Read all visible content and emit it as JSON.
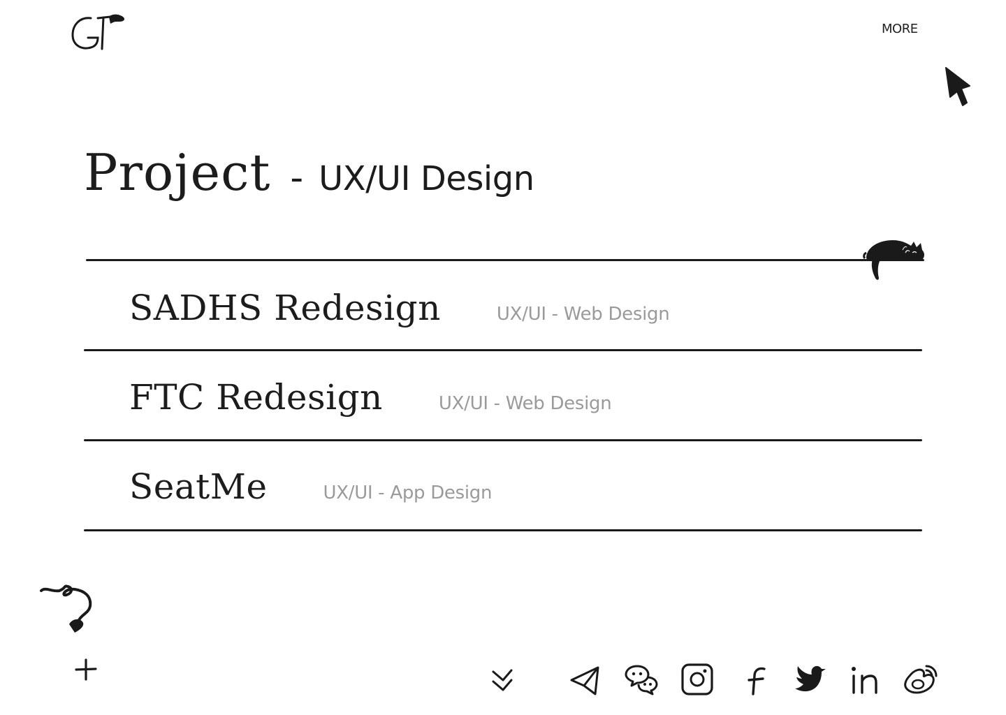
{
  "header": {
    "logo_alt": "GT",
    "more_label": "MORE"
  },
  "page": {
    "title": "Project",
    "separator": "-",
    "subtitle": "UX/UI Design"
  },
  "projects": [
    {
      "name": "SADHS Redesign",
      "category": "UX/UI - Web Design"
    },
    {
      "name": "FTC Redesign",
      "category": "UX/UI - Web Design"
    },
    {
      "name": "SeatMe",
      "category": "UX/UI - App Design"
    }
  ],
  "footer": {
    "icons": [
      "scroll-down-icon",
      "telegram-icon",
      "wechat-icon",
      "instagram-icon",
      "facebook-icon",
      "twitter-icon",
      "linkedin-icon",
      "weibo-icon"
    ]
  },
  "colors": {
    "ink": "#1a1a1a",
    "muted": "#9a9a9a",
    "background": "#ffffff"
  }
}
